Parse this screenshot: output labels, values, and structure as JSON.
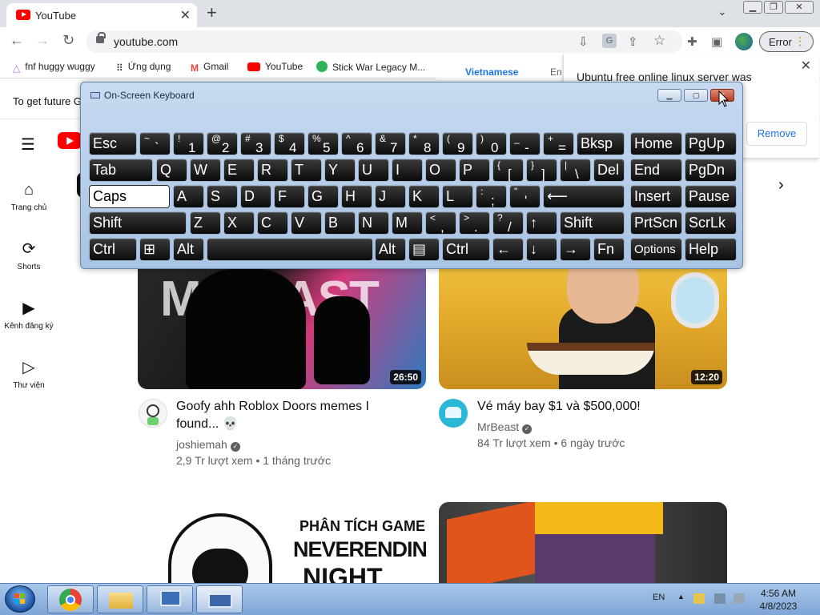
{
  "browser": {
    "tab_title": "YouTube",
    "tab_close": "✕",
    "new_tab": "+",
    "url": "youtube.com",
    "profile_button": "Error",
    "bookmarks": [
      {
        "label": "fnf huggy wuggy",
        "icon": "triangle-icon"
      },
      {
        "label": "Ứng dụng",
        "icon": "apps-grid-icon"
      },
      {
        "label": "Gmail",
        "icon": "gmail-icon"
      },
      {
        "label": "YouTube",
        "icon": "youtube-icon"
      },
      {
        "label": "Stick War Legacy M...",
        "icon": "stick-war-icon"
      }
    ]
  },
  "translate_popup": {
    "language_tab": "Vietnamese",
    "other_tab": "En"
  },
  "notification": {
    "message": "Ubuntu free online linux server was",
    "button": "Remove",
    "close": "✕"
  },
  "banner": {
    "text": "To get future G"
  },
  "sidebar": {
    "items": [
      {
        "label": "Trang chủ",
        "icon": "home-icon"
      },
      {
        "label": "Shorts",
        "icon": "shorts-icon"
      },
      {
        "label": "Kênh đăng ký",
        "icon": "subscriptions-icon"
      },
      {
        "label": "Thư viện",
        "icon": "library-icon"
      }
    ]
  },
  "videos": [
    {
      "title_line1": "Goofy ahh Roblox Doors memes I",
      "title_line2": "found... 💀",
      "channel": "joshiemah",
      "meta": "2,9 Tr lượt xem • 1 tháng trước",
      "duration": "26:50",
      "thumb_text": "MrBEAST"
    },
    {
      "title_line1": "Vé máy bay $1 và $500,000!",
      "title_line2": "",
      "channel": "MrBeast",
      "meta": "84 Tr lượt xem • 6 ngày trước",
      "duration": "12:20"
    },
    {
      "thumb_line1": "PHÂN TÍCH GAME",
      "thumb_line2": "NEVERENDING",
      "thumb_line3": "NIGHT"
    }
  ],
  "osk": {
    "title": "On-Screen Keyboard",
    "rows": [
      [
        {
          "label": "Esc"
        },
        {
          "shift": "~",
          "base": "`"
        },
        {
          "shift": "!",
          "base": "1"
        },
        {
          "shift": "@",
          "base": "2"
        },
        {
          "shift": "#",
          "base": "3"
        },
        {
          "shift": "$",
          "base": "4"
        },
        {
          "shift": "%",
          "base": "5"
        },
        {
          "shift": "^",
          "base": "6"
        },
        {
          "shift": "&",
          "base": "7"
        },
        {
          "shift": "*",
          "base": "8"
        },
        {
          "shift": "(",
          "base": "9"
        },
        {
          "shift": ")",
          "base": "0"
        },
        {
          "shift": "_",
          "base": "-"
        },
        {
          "shift": "+",
          "base": "="
        },
        {
          "label": "Bksp"
        },
        {
          "label": "Home"
        },
        {
          "label": "PgUp"
        }
      ],
      [
        {
          "label": "Tab"
        },
        {
          "label": "Q"
        },
        {
          "label": "W"
        },
        {
          "label": "E"
        },
        {
          "label": "R"
        },
        {
          "label": "T"
        },
        {
          "label": "Y"
        },
        {
          "label": "U"
        },
        {
          "label": "I"
        },
        {
          "label": "O"
        },
        {
          "label": "P"
        },
        {
          "shift": "{",
          "base": "["
        },
        {
          "shift": "}",
          "base": "]"
        },
        {
          "shift": "|",
          "base": "\\"
        },
        {
          "label": "Del"
        },
        {
          "label": "End"
        },
        {
          "label": "PgDn"
        }
      ],
      [
        {
          "label": "Caps"
        },
        {
          "label": "A"
        },
        {
          "label": "S"
        },
        {
          "label": "D"
        },
        {
          "label": "F"
        },
        {
          "label": "G"
        },
        {
          "label": "H"
        },
        {
          "label": "J"
        },
        {
          "label": "K"
        },
        {
          "label": "L"
        },
        {
          "shift": ":",
          "base": ";"
        },
        {
          "shift": "\"",
          "base": "'"
        },
        {
          "label": "⟵"
        },
        {
          "label": "Insert"
        },
        {
          "label": "Pause"
        }
      ],
      [
        {
          "label": "Shift"
        },
        {
          "label": "Z"
        },
        {
          "label": "X"
        },
        {
          "label": "C"
        },
        {
          "label": "V"
        },
        {
          "label": "B"
        },
        {
          "label": "N"
        },
        {
          "label": "M"
        },
        {
          "shift": "<",
          "base": ","
        },
        {
          "shift": ">",
          "base": "."
        },
        {
          "shift": "?",
          "base": "/"
        },
        {
          "label": "↑"
        },
        {
          "label": "Shift"
        },
        {
          "label": "PrtScn"
        },
        {
          "label": "ScrLk"
        }
      ],
      [
        {
          "label": "Ctrl"
        },
        {
          "label": "⊞"
        },
        {
          "label": "Alt"
        },
        {
          "label": ""
        },
        {
          "label": "Alt"
        },
        {
          "label": "▤"
        },
        {
          "label": "Ctrl"
        },
        {
          "label": "←"
        },
        {
          "label": "↓"
        },
        {
          "label": "→"
        },
        {
          "label": "Fn"
        },
        {
          "label": "Options"
        },
        {
          "label": "Help"
        }
      ]
    ]
  },
  "taskbar": {
    "language": "EN",
    "time": "4:56 AM",
    "date": "4/8/2023"
  },
  "colors": {
    "youtube_red": "#ff0000",
    "osk_key": "#111111",
    "taskbar": "#a9c7ea"
  }
}
